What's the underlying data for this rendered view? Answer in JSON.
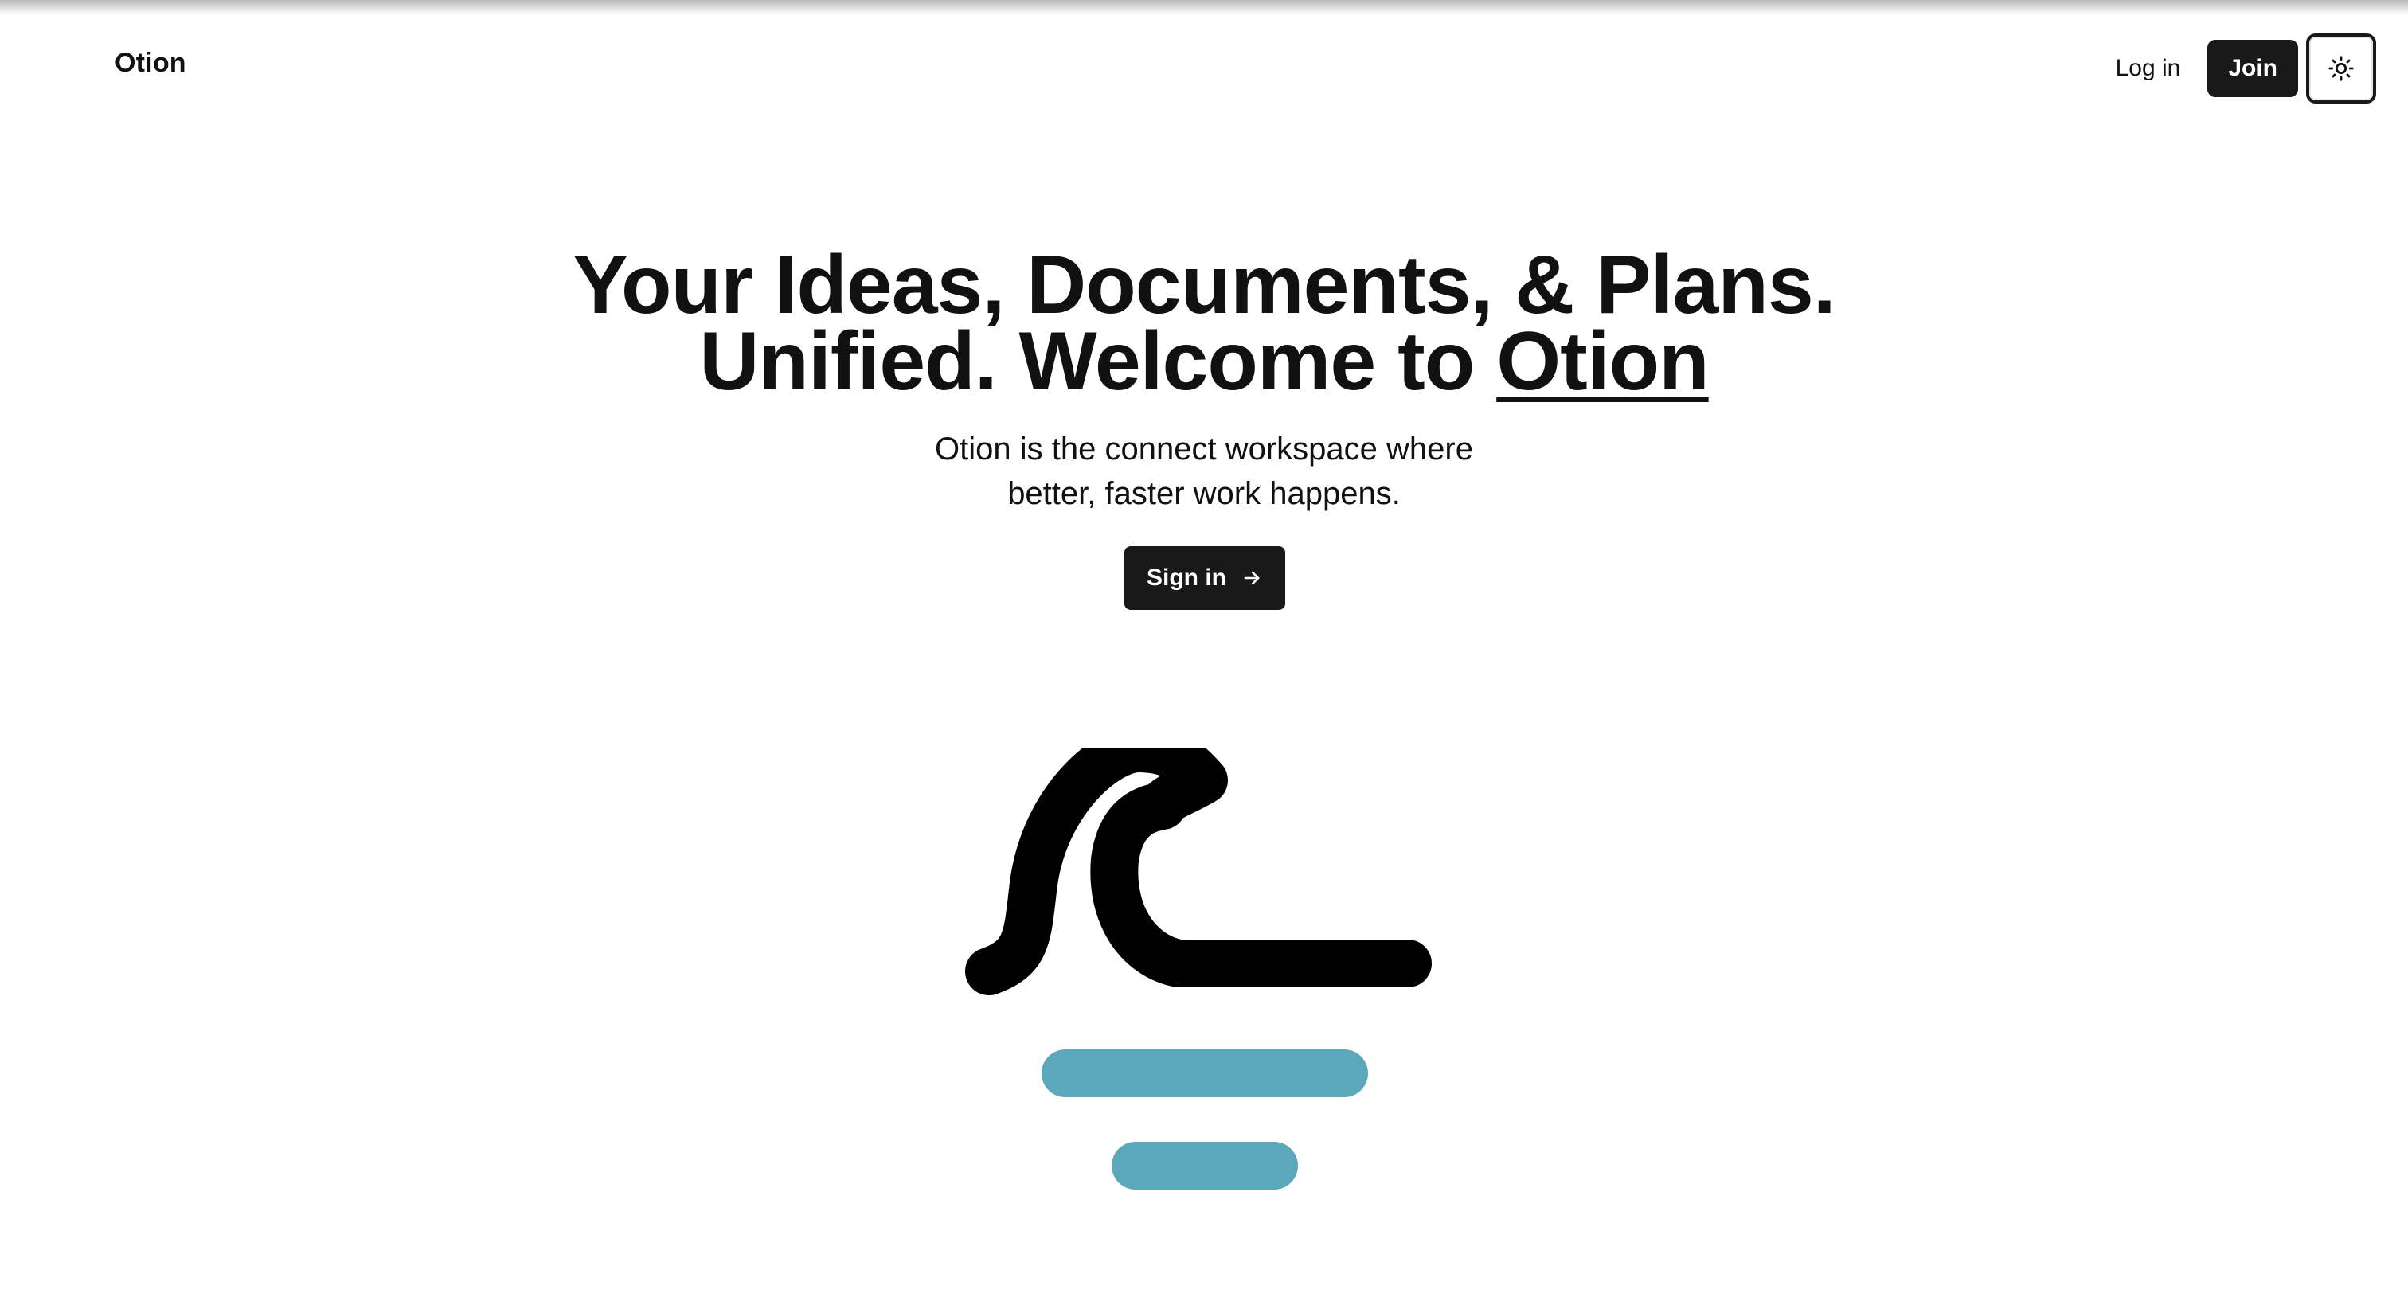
{
  "header": {
    "brand": "Otion",
    "login_label": "Log in",
    "join_label": "Join",
    "theme_icon": "sun-icon"
  },
  "hero": {
    "headline_line1": "Your Ideas, Documents, & Plans.",
    "headline_line2_prefix": "Unified. Welcome to ",
    "headline_brand": "Otion",
    "subtitle_line1": "Otion is the connect workspace where",
    "subtitle_line2": "better, faster work happens.",
    "cta_label": "Sign in",
    "cta_icon": "arrow-right-icon"
  },
  "illustration": {
    "name": "wave-logo",
    "wave_color": "#000000",
    "bar_color": "#5AA8BA"
  }
}
